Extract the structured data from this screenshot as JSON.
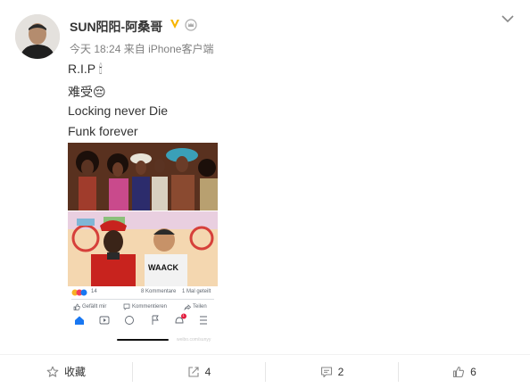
{
  "post": {
    "username": "SUN阳阳-阿桑哥",
    "time": "今天 18:24",
    "source_prefix": "来自",
    "source_device": "iPhone客户端",
    "lines": [
      "R.I.P 🕯",
      "难受😔",
      "Locking never Die",
      "Funk forever"
    ]
  },
  "embedded_fb": {
    "reaction_count": "14",
    "comments": "8 Kommentare",
    "shares": "1 Mal geteilt",
    "like_label": "Gefällt mir",
    "comment_label": "Kommentieren",
    "share_label": "Teilen",
    "notif_count": "1",
    "watermark": "weibo.com/sunyy"
  },
  "actions": {
    "favorite_label": "收藏",
    "repost_count": "4",
    "comment_count": "2",
    "like_count": "6"
  },
  "colors": {
    "verified": "#f7b500",
    "link": "#eb7350",
    "fb_blue": "#1877f2"
  }
}
